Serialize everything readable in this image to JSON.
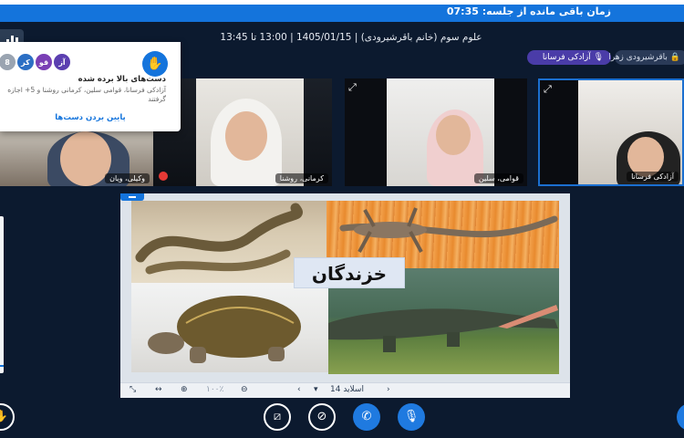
{
  "timer": {
    "label": "زمان باقی مانده از جلسه: 07:35"
  },
  "meeting": {
    "title": "علوم سوم (خانم باقرشیرودی) | 1405/01/15 | 13:00 تا 13:45"
  },
  "speakers": [
    {
      "name": "آزادکی فرسانا",
      "active": true
    },
    {
      "name": "باقرشیرودی زهرا",
      "active": false
    }
  ],
  "tiles": [
    {
      "name": "وکیلی، ویان"
    },
    {
      "name": "کرمانی، روشنا"
    },
    {
      "name": "قوامی، سلین"
    },
    {
      "name": "آزادکی فرسانا"
    }
  ],
  "raised_hands": {
    "title": "دست‌های بالا برده شده",
    "body": "آزادکی فرسانا، قوامی سلین، کرمانی روشنا و 5+ اجازه گرفتند",
    "lower_all_label": "پایین بردن دست‌ها",
    "avatars": [
      {
        "initials": "آز",
        "color": "#5b3fb0"
      },
      {
        "initials": "قو",
        "color": "#7a3fb5"
      },
      {
        "initials": "کر",
        "color": "#2c6fc4"
      },
      {
        "initials": "8",
        "color": "#9aa4b1"
      }
    ]
  },
  "slide": {
    "title": "خزندگان",
    "images": [
      "snake",
      "lizard",
      "turtle",
      "crocodile"
    ],
    "toolbar": {
      "slide_label": "اسلاید 14",
      "zoom_label": "۱۰۰٪"
    }
  },
  "icons": {
    "hand": "hand-raise-icon",
    "expand": "expand-icon",
    "stats": "bar-chart-icon",
    "screen_share_off": "screen-share-off-icon",
    "video_off": "video-off-icon",
    "phone": "phone-icon",
    "mic": "microphone-icon",
    "lock": "lock-icon"
  }
}
